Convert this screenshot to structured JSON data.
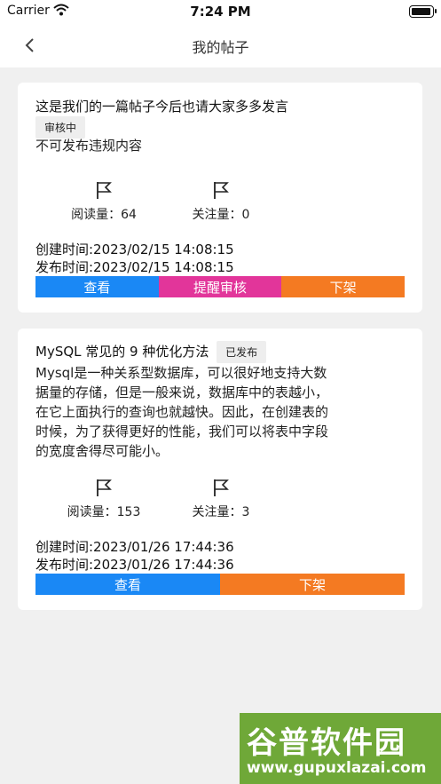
{
  "status_bar": {
    "carrier": "Carrier",
    "time": "7:24 PM"
  },
  "nav": {
    "title": "我的帖子"
  },
  "posts": [
    {
      "title": "这是我们的一篇帖子今后也请大家多多发言",
      "status": "审核中",
      "content": [
        "不可发布违规内容"
      ],
      "reads": "阅读量：64",
      "follows": "关注量：0",
      "created": "创建时间:2023/02/15 14:08:15",
      "published": "发布时间:2023/02/15 14:08:15",
      "actions": [
        "查看",
        "提醒审核",
        "下架"
      ]
    },
    {
      "title": "MySQL 常见的 9 种优化方法",
      "status": "已发布",
      "content": [
        "Mysql是一种关系型数据库，可以很好地支持大数",
        "据量的存储，但是一般来说，数据库中的表越小，",
        "在它上面执行的查询也就越快。因此，在创建表的",
        "时候，为了获得更好的性能，我们可以将表中字段",
        "的宽度舍得尽可能小。"
      ],
      "reads": "阅读量：153",
      "follows": "关注量：3",
      "created": "创建时间:2023/01/26 17:44:36",
      "published": "发布时间:2023/01/26 17:44:36",
      "actions": [
        "查看",
        "下架"
      ]
    }
  ],
  "watermark": {
    "text": "谷普软件园",
    "url": "www.gupuxlazai.com"
  },
  "colors": {
    "view": "#1a88f5",
    "remind": "#e2359a",
    "unpublish": "#f47a22"
  }
}
